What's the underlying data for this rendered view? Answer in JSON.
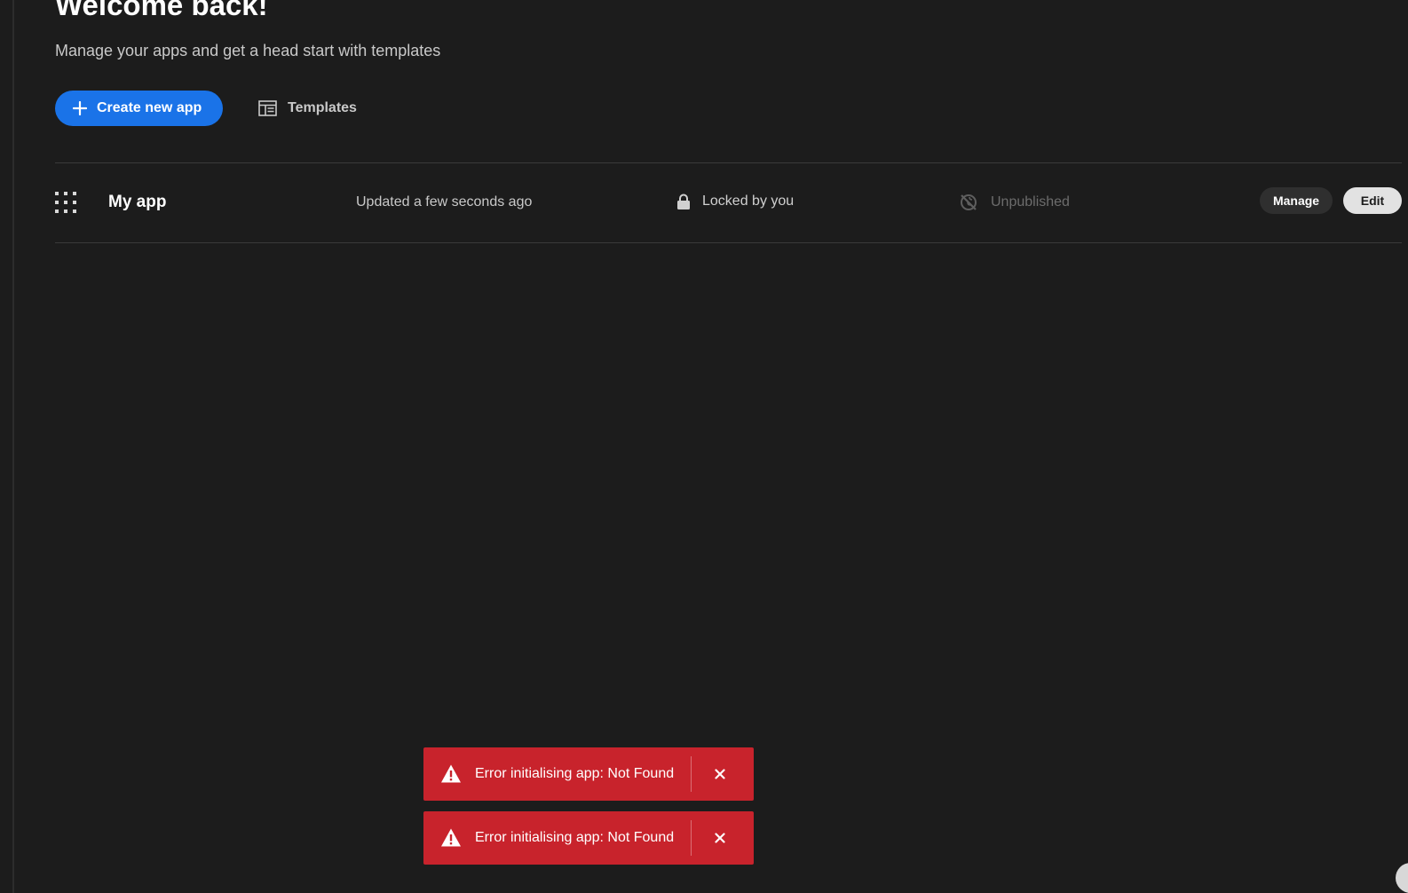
{
  "header": {
    "title": "Welcome back!",
    "subtitle": "Manage your apps and get a head start with templates"
  },
  "actions": {
    "create_label": "Create new app",
    "templates_label": "Templates"
  },
  "apps": [
    {
      "name": "My app",
      "updated": "Updated a few seconds ago",
      "lock_status": "Locked by you",
      "publish_status": "Unpublished",
      "manage_label": "Manage",
      "edit_label": "Edit"
    }
  ],
  "toasts": [
    {
      "message": "Error initialising app: Not Found"
    },
    {
      "message": "Error initialising app: Not Found"
    }
  ],
  "icons": {
    "create": "plus-icon",
    "templates": "templates-icon",
    "app": "grid-icon",
    "lock": "lock-icon",
    "unpublished": "unpublished-icon",
    "toast": "warning-icon",
    "dismiss": "close-icon"
  },
  "colors": {
    "background": "#1c1c1c",
    "primary": "#1a73e8",
    "error": "#c8232c",
    "edit_button": "#e2e2e2",
    "manage_button": "#2f2f2f"
  }
}
